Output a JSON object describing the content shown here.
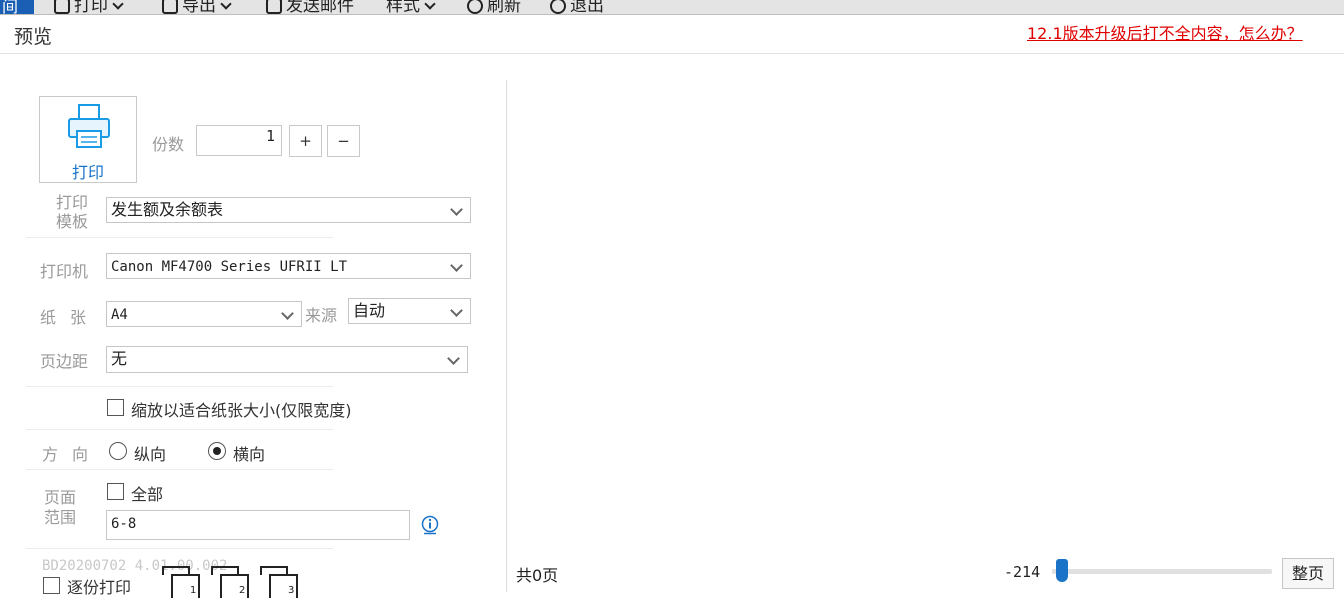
{
  "toolbar": {
    "left_tab": "间",
    "items": [
      {
        "label": "打印",
        "icon": "printer-icon"
      },
      {
        "label": "导出",
        "icon": "export-icon"
      },
      {
        "label": "发送邮件",
        "icon": "mail-icon"
      },
      {
        "label": "样式",
        "icon": ""
      },
      {
        "label": "刷新",
        "icon": "refresh-icon"
      },
      {
        "label": "退出",
        "icon": "close-circle-icon"
      }
    ]
  },
  "header": {
    "title": "预览",
    "help_link": "12.1版本升级后打不全内容，怎么办？"
  },
  "print_panel": {
    "print_button": "打印",
    "copies_label": "份数",
    "copies_value": "1",
    "plus": "+",
    "minus": "−",
    "template_label": "打印\n模板",
    "template_value": "发生额及余额表",
    "printer_label": "打印机",
    "printer_value": "Canon MF4700 Series UFRII LT",
    "paper_label": "纸张",
    "paper_value": "A4",
    "source_label": "来源",
    "source_value": "自动",
    "margin_label": "页边距",
    "margin_value": "无",
    "fit_label": "缩放以适合纸张大小(仅限宽度)",
    "fit_checked": false,
    "orientation_label": "方向",
    "portrait_label": "纵向",
    "landscape_label": "横向",
    "orientation": "landscape",
    "range_label": "页面\n范围",
    "all_label": "全部",
    "all_checked": false,
    "range_value": "6-8",
    "version": "BD20200702 4.01.00.002",
    "collate_label": "逐份打印",
    "stack_icons": [
      "1",
      "2",
      "3"
    ]
  },
  "preview": {
    "page_count": "共0页",
    "zoom_value": "-214",
    "zoom_level": 0.02,
    "fit_page_button": "整页"
  },
  "colors": {
    "accent": "#1a73c8",
    "link": "#e00000"
  }
}
